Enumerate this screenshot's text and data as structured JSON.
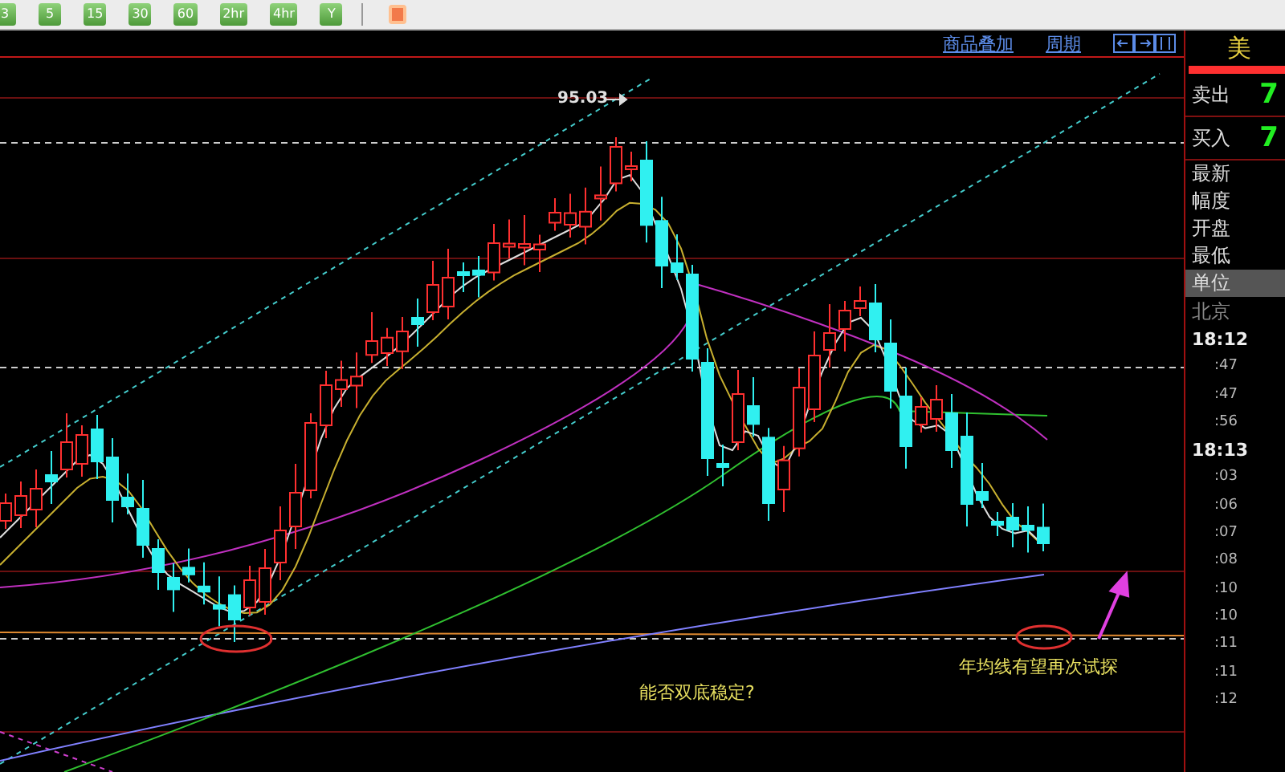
{
  "toolbar": {
    "periods": [
      "3",
      "5",
      "15",
      "30",
      "60",
      "2hr",
      "4hr",
      "Y"
    ]
  },
  "chart_header": {
    "links": [
      "商品叠加",
      "周期"
    ]
  },
  "chart": {
    "peak_label": "95.03",
    "annotations": [
      "能否双底稳定?",
      "年均线有望再次试探"
    ]
  },
  "quote_panel": {
    "title": "美",
    "trade_rows": [
      {
        "label": "卖出",
        "value": "7"
      },
      {
        "label": "买入",
        "value": "7"
      }
    ],
    "fields": [
      {
        "label": "最新",
        "selected": false
      },
      {
        "label": "幅度",
        "selected": false
      },
      {
        "label": "开盘",
        "selected": false
      },
      {
        "label": "最低",
        "selected": false
      },
      {
        "label": "单位",
        "selected": true
      }
    ],
    "zone": "北京",
    "ticks": [
      {
        "time": "18:12",
        "kind": "minute"
      },
      {
        "time": ":47",
        "kind": "second"
      },
      {
        "time": ":47",
        "kind": "second"
      },
      {
        "time": ":56",
        "kind": "second"
      },
      {
        "time": "18:13",
        "kind": "minute"
      },
      {
        "time": ":03",
        "kind": "second"
      },
      {
        "time": ":06",
        "kind": "second"
      },
      {
        "time": ":07",
        "kind": "second"
      },
      {
        "time": ":08",
        "kind": "second"
      },
      {
        "time": ":10",
        "kind": "second"
      },
      {
        "time": ":10",
        "kind": "second"
      },
      {
        "time": ":11",
        "kind": "second"
      },
      {
        "time": ":11",
        "kind": "second"
      },
      {
        "time": ":12",
        "kind": "second"
      }
    ]
  }
}
